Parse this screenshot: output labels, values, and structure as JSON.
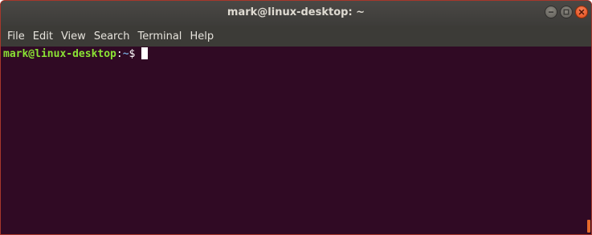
{
  "window": {
    "title": "mark@linux-desktop: ~",
    "controls": [
      {
        "name": "minimize",
        "icon": "minimize-icon"
      },
      {
        "name": "maximize",
        "icon": "maximize-icon"
      },
      {
        "name": "close",
        "icon": "close-icon"
      }
    ]
  },
  "menubar": {
    "items": [
      "File",
      "Edit",
      "View",
      "Search",
      "Terminal",
      "Help"
    ]
  },
  "terminal": {
    "prompt_user_host": "mark@linux-desktop",
    "prompt_separator": ":",
    "prompt_path": "~",
    "prompt_symbol": "$",
    "colors": {
      "background": "#300a24",
      "user_host": "#8ae234",
      "path": "#729fcf",
      "text": "#ffffff"
    }
  },
  "colors": {
    "titlebar": "#3d3c39",
    "menubar": "#3c3b37",
    "close_button": "#df4a16",
    "scrollbar_thumb": "#e46a2b"
  }
}
